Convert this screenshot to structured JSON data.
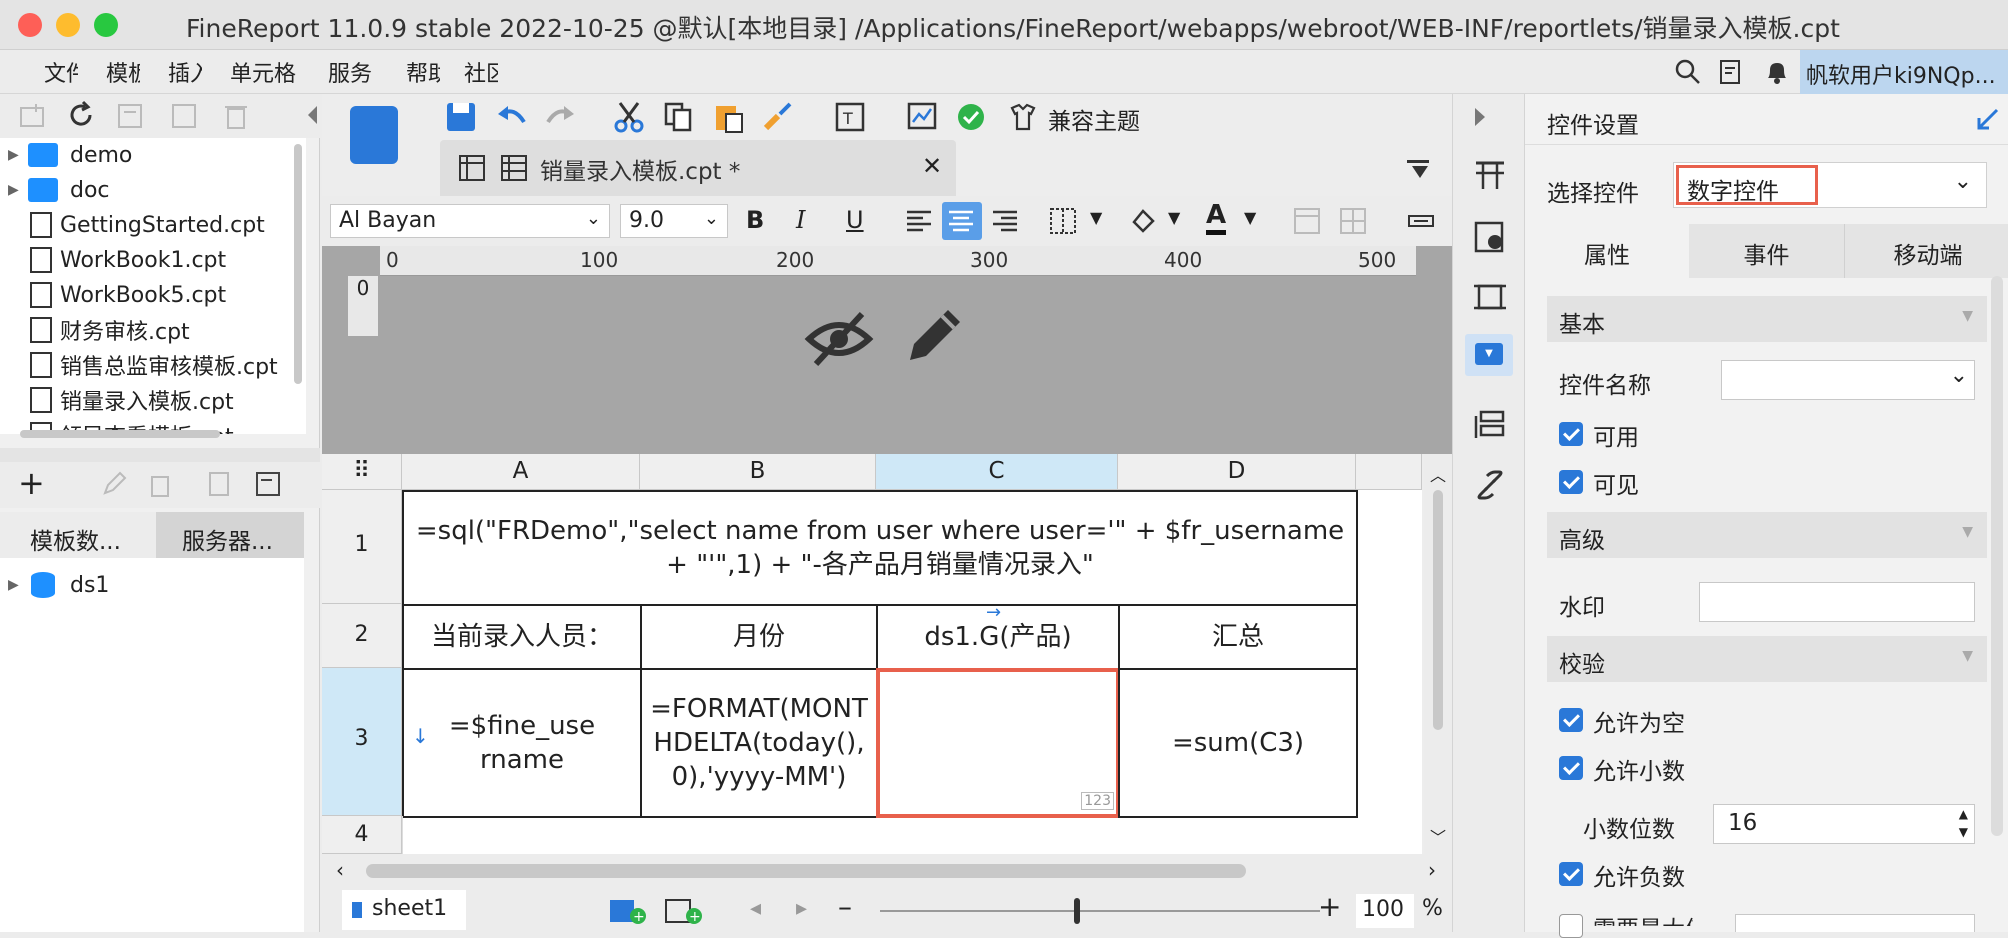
{
  "window": {
    "title": "FineReport 11.0.9 stable 2022-10-25 @默认[本地目录]   /Applications/FineReport/webapps/webroot/WEB-INF/reportlets/销量录入模板.cpt"
  },
  "menu": {
    "items": [
      "文件",
      "模板",
      "插入",
      "单元格",
      "服务",
      "帮助",
      "社区"
    ],
    "user": "帆软用户ki9NQp..."
  },
  "file_tree": {
    "items": [
      {
        "type": "folder",
        "label": "demo"
      },
      {
        "type": "folder",
        "label": "doc"
      },
      {
        "type": "file",
        "label": "GettingStarted.cpt"
      },
      {
        "type": "file",
        "label": "WorkBook1.cpt"
      },
      {
        "type": "file",
        "label": "WorkBook5.cpt"
      },
      {
        "type": "file",
        "label": "财务审核.cpt"
      },
      {
        "type": "file",
        "label": "销售总监审核模板.cpt"
      },
      {
        "type": "file",
        "label": "销量录入模板.cpt"
      },
      {
        "type": "file",
        "label": "领导查看模板.cpt"
      }
    ]
  },
  "datasets": {
    "tabs": [
      "模板数...",
      "服务器..."
    ],
    "items": [
      "ds1"
    ]
  },
  "toolbar": {
    "theme_label": "兼容主题"
  },
  "tab": {
    "label": "销量录入模板.cpt *"
  },
  "format": {
    "font": "Al Bayan",
    "size": "9.0"
  },
  "ruler": {
    "ticks": [
      "0",
      "100",
      "200",
      "300",
      "400",
      "500"
    ],
    "vertical": "0"
  },
  "sheet": {
    "columns": [
      "A",
      "B",
      "C",
      "D"
    ],
    "rows": [
      "1",
      "2",
      "3",
      "4"
    ],
    "cells": {
      "a1": "=sql(\"FRDemo\",\"select name from user where user='\" + $fr_username + \"'\",1) + \"-各产品月销量情况录入\"",
      "a2": "当前录入人员：",
      "b2": "月份",
      "c2": "ds1.G(产品)",
      "d2": "汇总",
      "a3": "=$fine_username",
      "b3": "=FORMAT(MONTHDELTA(today(),0),'yyyy-MM')",
      "c3_badge": "123",
      "d3": "=sum(C3)"
    },
    "tab": "sheet1",
    "zoom": "100",
    "zoom_unit": "%"
  },
  "panel": {
    "title": "控件设置",
    "select_label": "选择控件",
    "select_value": "数字控件",
    "tabs": [
      "属性",
      "事件",
      "移动端"
    ],
    "sections": {
      "basic": "基本",
      "advanced": "高级",
      "validate": "校验"
    },
    "name_label": "控件名称",
    "enabled": "可用",
    "visible": "可见",
    "watermark": "水印",
    "allow_empty": "允许为空",
    "allow_decimal": "允许小数",
    "decimal_digits_label": "小数位数",
    "decimal_digits": "16",
    "allow_negative": "允许负数",
    "need_max": "需要最大值"
  },
  "colors": {
    "accent": "#2a78d8",
    "highlight": "#e8604c",
    "selected_col": "#cfe8f7"
  }
}
